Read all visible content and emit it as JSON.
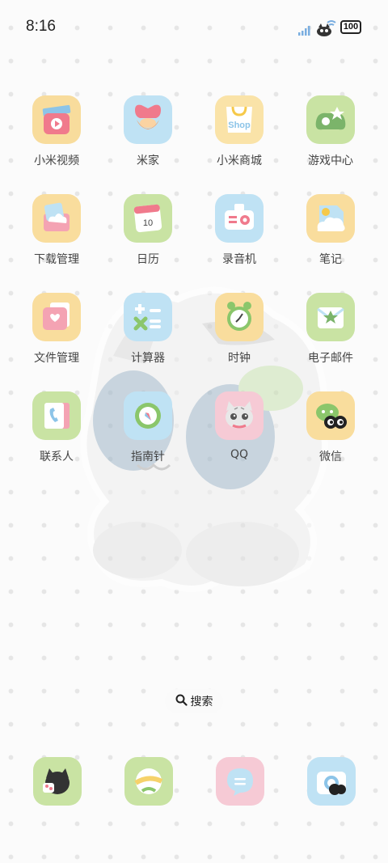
{
  "status_bar": {
    "time": "8:16",
    "battery": "100",
    "icons": [
      "signal-icon",
      "wifi-cat-icon",
      "battery-icon"
    ]
  },
  "apps": [
    {
      "label": "小米视频",
      "icon": "video-player-icon",
      "color": "#f8dc9c"
    },
    {
      "label": "米家",
      "icon": "home-heart-icon",
      "color": "#bfe2f4"
    },
    {
      "label": "小米商城",
      "icon": "shop-bag-icon",
      "color": "#fae3a8"
    },
    {
      "label": "游戏中心",
      "icon": "game-controller-icon",
      "color": "#c9e3a3"
    },
    {
      "label": "下载管理",
      "icon": "download-cloud-icon",
      "color": "#f9dd9d"
    },
    {
      "label": "日历",
      "icon": "calendar-icon",
      "color": "#c9e3a3"
    },
    {
      "label": "录音机",
      "icon": "recorder-icon",
      "color": "#bfe2f4"
    },
    {
      "label": "笔记",
      "icon": "notes-cloud-icon",
      "color": "#f9dd9d"
    },
    {
      "label": "文件管理",
      "icon": "folder-heart-icon",
      "color": "#f9dd9d"
    },
    {
      "label": "计算器",
      "icon": "calculator-icon",
      "color": "#bfe2f4"
    },
    {
      "label": "时钟",
      "icon": "clock-icon",
      "color": "#f9dd9d"
    },
    {
      "label": "电子邮件",
      "icon": "mail-star-icon",
      "color": "#c9e3a3"
    },
    {
      "label": "联系人",
      "icon": "contacts-phone-icon",
      "color": "#c9e3a3"
    },
    {
      "label": "指南针",
      "icon": "compass-icon",
      "color": "#bfe2f4"
    },
    {
      "label": "QQ",
      "icon": "qq-cat-icon",
      "color": "#f6cad5"
    },
    {
      "label": "微信",
      "icon": "wechat-bubble-icon",
      "color": "#f9dd9d"
    }
  ],
  "search": {
    "label": "搜索",
    "icon": "search-icon"
  },
  "dock": [
    {
      "icon": "phone-cat-icon",
      "color": "#c9e3a3"
    },
    {
      "icon": "browser-ball-icon",
      "color": "#c9e3a3"
    },
    {
      "icon": "messages-bubble-icon",
      "color": "#f6cad5"
    },
    {
      "icon": "camera-cat-icon",
      "color": "#bfe2f4"
    }
  ]
}
